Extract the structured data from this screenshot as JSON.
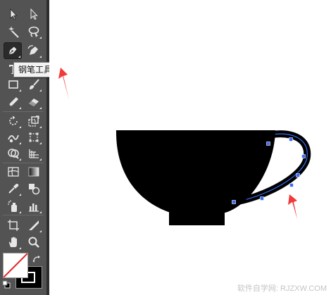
{
  "toolbar": {
    "tools": [
      {
        "name": "selection-tool",
        "icon": "arrow-icon"
      },
      {
        "name": "direct-selection-tool",
        "icon": "white-arrow-icon"
      },
      {
        "name": "magic-wand-tool",
        "icon": "magic-wand-icon"
      },
      {
        "name": "lasso-tool",
        "icon": "lasso-icon"
      },
      {
        "name": "pen-tool",
        "icon": "pen-icon",
        "active": true
      },
      {
        "name": "curvature-tool",
        "icon": "curvature-pen-icon"
      },
      {
        "name": "type-tool",
        "icon": "type-icon"
      },
      {
        "name": "rectangle-tool",
        "icon": "rectangle-icon"
      },
      {
        "name": "paintbrush-tool",
        "icon": "paintbrush-icon"
      },
      {
        "name": "pencil-tool",
        "icon": "pencil-icon"
      },
      {
        "name": "eraser-tool",
        "icon": "eraser-icon"
      },
      {
        "name": "rotate-tool",
        "icon": "rotate-icon"
      },
      {
        "name": "scale-tool",
        "icon": "scale-icon"
      },
      {
        "name": "warp-tool",
        "icon": "warp-icon"
      },
      {
        "name": "free-transform-tool",
        "icon": "free-transform-icon"
      },
      {
        "name": "shape-builder-tool",
        "icon": "shape-builder-icon"
      },
      {
        "name": "perspective-grid-tool",
        "icon": "perspective-grid-icon"
      },
      {
        "name": "mesh-tool",
        "icon": "mesh-icon"
      },
      {
        "name": "gradient-tool",
        "icon": "gradient-icon"
      },
      {
        "name": "eyedropper-tool",
        "icon": "eyedropper-icon"
      },
      {
        "name": "blend-tool",
        "icon": "blend-icon"
      },
      {
        "name": "symbol-sprayer-tool",
        "icon": "symbol-sprayer-icon"
      },
      {
        "name": "column-graph-tool",
        "icon": "column-graph-icon"
      },
      {
        "name": "artboard-tool",
        "icon": "artboard-icon"
      },
      {
        "name": "slice-tool",
        "icon": "slice-icon"
      },
      {
        "name": "hand-tool",
        "icon": "hand-icon"
      },
      {
        "name": "zoom-tool",
        "icon": "zoom-icon"
      }
    ],
    "tooltip": "钢笔工具 (P)"
  },
  "colors": {
    "toolbar_bg": "#535353",
    "artwork_fill": "#000000",
    "path_highlight": "#3a6cf4",
    "annotation_arrow": "#f23a3a",
    "no_fill_slash": "#e02424"
  },
  "watermark": "软件自学网: RJZXW.COM"
}
